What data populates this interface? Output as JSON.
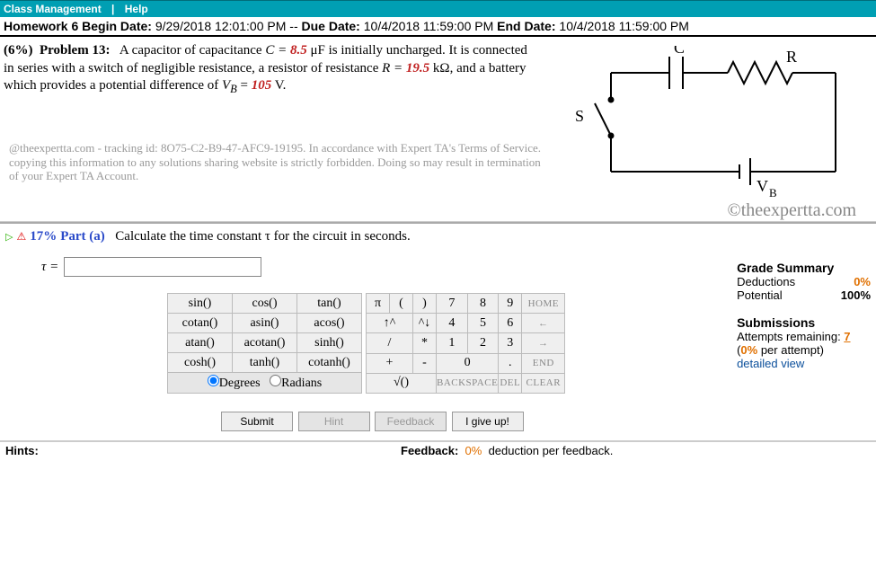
{
  "nav": {
    "class_mgmt": "Class Management",
    "help": "Help"
  },
  "dates": {
    "hw_label": "Homework 6 Begin Date:",
    "begin": "9/29/2018 12:01:00 PM",
    "due_label": "Due Date:",
    "due": "10/4/2018 11:59:00 PM",
    "end_label": "End Date:",
    "end": "10/4/2018 11:59:00 PM"
  },
  "problem": {
    "percent": "(6%)",
    "number": "Problem 13:",
    "t1": "A capacitor of capacitance ",
    "c_eq": "C = ",
    "c_val": "8.5",
    "c_unit": " μF is initially uncharged. It is connected in series with a switch of negligible resistance, a resistor of resistance ",
    "r_eq": "R = ",
    "r_val": "19.5",
    "r_unit": " kΩ, and a battery which provides a potential difference of ",
    "v_eq": "V",
    "v_sub": "B",
    "v_eq2": " = ",
    "v_val": "105",
    "v_unit": " V."
  },
  "circuit_labels": {
    "C": "C",
    "R": "R",
    "S": "S",
    "V": "V",
    "Vsub": "B"
  },
  "watermark": "©theexpertta.com",
  "tracking": "@theexpertta.com - tracking id: 8O75-C2-B9-47-AFC9-19195. In accordance with Expert TA's Terms of Service. copying this information to any solutions sharing website is strictly forbidden. Doing so may result in termination of your Expert TA Account.",
  "part": {
    "pct": "17%",
    "label": "Part (a)",
    "text": "Calculate the time constant τ for the circuit in seconds."
  },
  "tau": {
    "label": "τ = ",
    "value": ""
  },
  "funcs": {
    "r1c1": "sin()",
    "r1c2": "cos()",
    "r1c3": "tan()",
    "r2c1": "cotan()",
    "r2c2": "asin()",
    "r2c3": "acos()",
    "r3c1": "atan()",
    "r3c2": "acotan()",
    "r3c3": "sinh()",
    "r4c1": "cosh()",
    "r4c2": "tanh()",
    "r4c3": "cotanh()",
    "deg": "Degrees",
    "rad": "Radians"
  },
  "keys": {
    "pi": "π",
    "lp": "(",
    "rp": ")",
    "k7": "7",
    "k8": "8",
    "k9": "9",
    "home": "HOME",
    "up": "↑^",
    "dn": "^↓",
    "k4": "4",
    "k5": "5",
    "k6": "6",
    "left": "←",
    "div": "/",
    "mul": "*",
    "k1": "1",
    "k2": "2",
    "k3": "3",
    "right": "→",
    "plus": "+",
    "minus": "-",
    "k0": "0",
    "dot": ".",
    "end": "END",
    "sqrt": "√()",
    "bksp": "BACKSPACE",
    "del": "DEL",
    "clear": "CLEAR"
  },
  "buttons": {
    "submit": "Submit",
    "hint": "Hint",
    "feedback": "Feedback",
    "giveup": "I give up!"
  },
  "grade": {
    "hdr": "Grade Summary",
    "ded_label": "Deductions",
    "ded_val": "0%",
    "pot_label": "Potential",
    "pot_val": "100%",
    "sub_hdr": "Submissions",
    "attempts_pre": "Attempts remaining: ",
    "attempts_val": "7",
    "per_attempt_pre": "(",
    "per_attempt_val": "0%",
    "per_attempt_post": " per attempt)",
    "detailed": "detailed view"
  },
  "footer": {
    "hints": "Hints:",
    "fb_label": "Feedback:",
    "fb_val": "0%",
    "fb_post": "deduction per feedback."
  }
}
